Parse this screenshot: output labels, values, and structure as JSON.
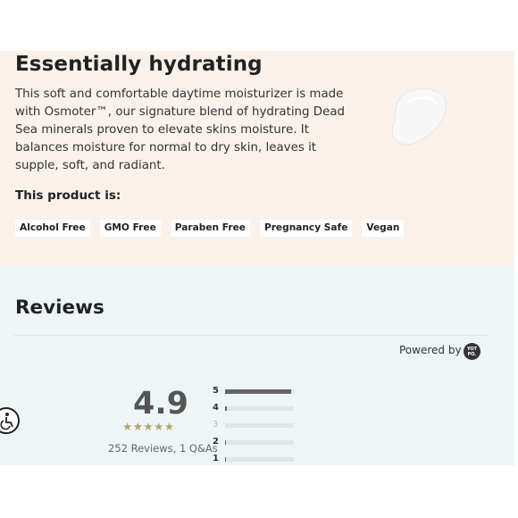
{
  "product": {
    "title": "Essentially hydrating",
    "description": "This soft and comfortable daytime moisturizer is made with Osmoter™, our signature blend of hydrating Dead Sea minerals proven to elevate skins moisture. It balances moisture for normal to dry skin, leaves it supple, soft, and radiant.",
    "attributes_heading": "This product is:",
    "tags": [
      "Alcohol Free",
      "GMO Free",
      "Paraben Free",
      "Pregnancy Safe",
      "Vegan"
    ],
    "colors": {
      "section_bg": "#f9f1ea"
    }
  },
  "reviews": {
    "title": "Reviews",
    "powered_by": "Powered by",
    "logo_text": "YOT PO.",
    "average": "4.9",
    "stars_display": "★★★★★",
    "totals": "252 Reviews, 1 Q&As",
    "distribution": [
      {
        "star": "5",
        "fraction": 0.96
      },
      {
        "star": "4",
        "fraction": 0.03
      },
      {
        "star": "3",
        "fraction": 0.0
      },
      {
        "star": "2",
        "fraction": 0.01
      },
      {
        "star": "1",
        "fraction": 0.01
      }
    ],
    "colors": {
      "section_bg": "#edf5f6",
      "star": "#b8a274",
      "bar": "#666666"
    }
  },
  "accessibility": {
    "icon": "accessibility-icon"
  }
}
